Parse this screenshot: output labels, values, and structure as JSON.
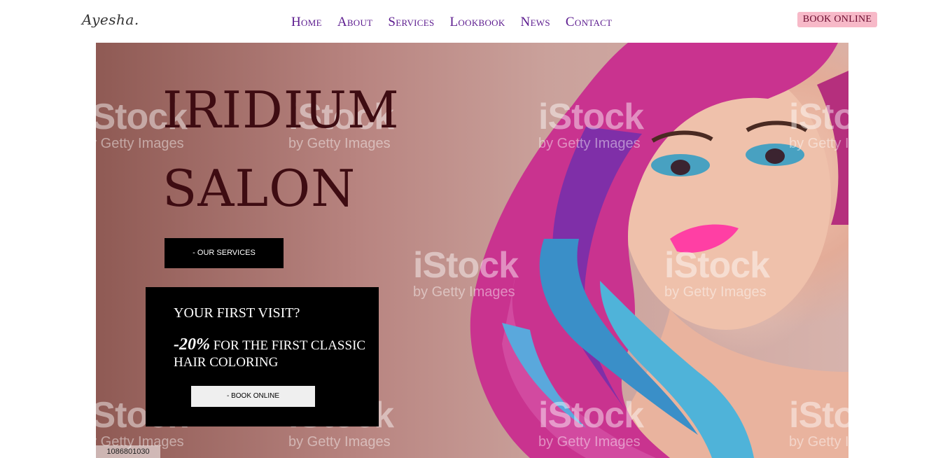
{
  "brand": {
    "logo": "Ayesha."
  },
  "nav": {
    "items": [
      "Home",
      "About",
      "Services",
      "Lookbook",
      "News",
      "Contact"
    ],
    "book_label": "BOOK ONLINE"
  },
  "hero": {
    "title_line1": "IRIDIUM",
    "title_line2": "SALON",
    "services_label": "- OUR SERVICES",
    "promo": {
      "question": "YOUR FIRST VISIT?",
      "discount": "-20%",
      "offer_text": " FOR THE FIRST CLASSIC HAIR COLORING",
      "book_label": "- BOOK ONLINE"
    },
    "watermark_brand": "iStock",
    "watermark_sub": "by Getty Images",
    "stock_id": "1086801030"
  },
  "colors": {
    "nav_text": "#5b1a8e",
    "book_button_bg": "#f7b9c8",
    "title": "#3e0c12",
    "promo_bg": "#000000"
  }
}
